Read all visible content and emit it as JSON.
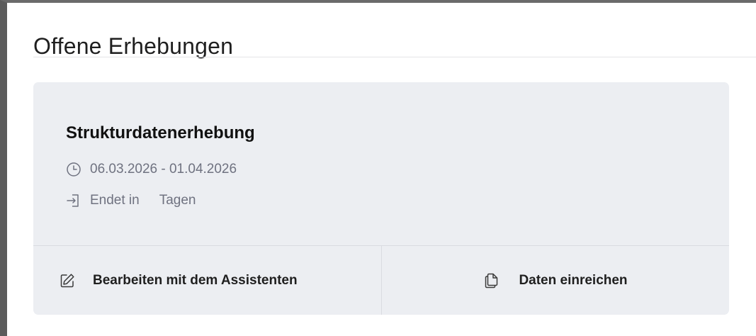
{
  "section": {
    "title": "Offene Erhebungen"
  },
  "survey": {
    "title": "Strukturdatenerhebung",
    "period": "06.03.2026 - 01.04.2026",
    "ends_prefix": "Endet in",
    "ends_suffix": "Tagen",
    "period_icon": "clock-icon",
    "ends_icon": "enter-icon"
  },
  "actions": {
    "edit_label": "Bearbeiten mit dem Assistenten",
    "edit_icon": "edit-icon",
    "submit_label": "Daten einreichen",
    "submit_icon": "copy-icon"
  },
  "colors": {
    "card_background": "#eceef2",
    "meta_text": "#6f7280",
    "divider": "#d9dbe1"
  }
}
